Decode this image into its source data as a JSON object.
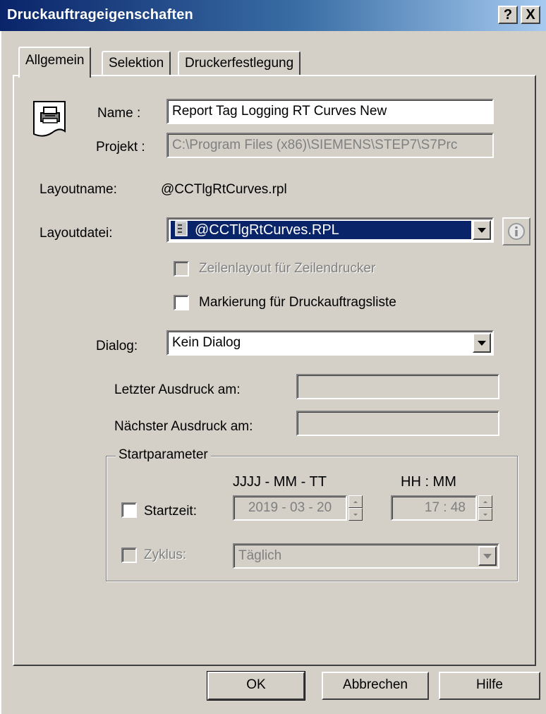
{
  "window": {
    "title": "Druckauftrageigenschaften",
    "help_btn": "?",
    "close_btn": "X"
  },
  "tabs": [
    {
      "label": "Allgemein",
      "active": true
    },
    {
      "label": "Selektion",
      "active": false
    },
    {
      "label": "Druckerfestlegung",
      "active": false
    }
  ],
  "general": {
    "name_label": "Name :",
    "name_value": "Report Tag Logging RT Curves New",
    "project_label": "Projekt :",
    "project_value": "C:\\Program Files (x86)\\SIEMENS\\STEP7\\S7Prc",
    "layoutname_label": "Layoutname:",
    "layoutname_value": "@CCTlgRtCurves.rpl",
    "layoutfile_label": "Layoutdatei:",
    "layoutfile_value": "@CCTlgRtCurves.RPL",
    "line_layout_label": "Zeilenlayout für Zeilendrucker",
    "line_layout_checked": false,
    "mark_label": "Markierung für Druckauftragsliste",
    "mark_checked": false,
    "dialog_label": "Dialog:",
    "dialog_value": "Kein Dialog",
    "last_print_label": "Letzter Ausdruck am:",
    "last_print_value": "",
    "next_print_label": "Nächster Ausdruck am:",
    "next_print_value": ""
  },
  "start": {
    "group_label": "Startparameter",
    "date_header": "JJJJ - MM - TT",
    "time_header": "HH : MM",
    "starttime_label": "Startzeit:",
    "starttime_checked": false,
    "date_value": "2019 - 03 - 20",
    "time_value": "17 : 48",
    "cycle_label": "Zyklus:",
    "cycle_checked": false,
    "cycle_value": "Täglich"
  },
  "buttons": {
    "ok": "OK",
    "cancel": "Abbrechen",
    "help": "Hilfe"
  },
  "colors": {
    "title_bar": "#0a246a",
    "selection": "#0a246a",
    "face": "#d4d0c8"
  }
}
